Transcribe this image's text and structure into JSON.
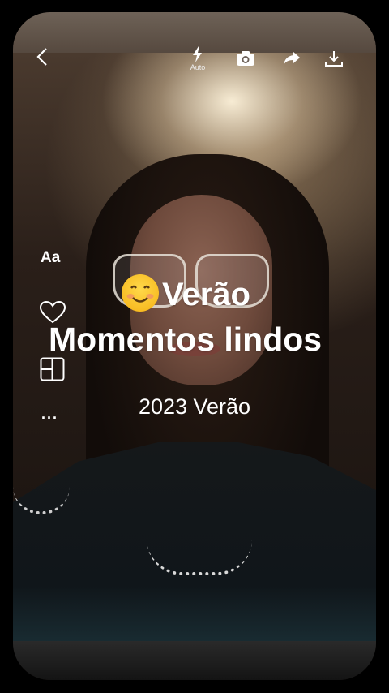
{
  "topbar": {
    "back_icon": "chevron-left-icon",
    "flash_icon": "flash-auto-icon",
    "flash_label": "Auto",
    "camera_icon": "camera-icon",
    "share_icon": "share-icon",
    "download_icon": "download-icon"
  },
  "side_tools": {
    "text_tool_label": "Aa",
    "like_icon": "heart-icon",
    "layout_icon": "layout-grid-icon",
    "more_label": "..."
  },
  "overlay": {
    "emoji": "smiling-face-emoji",
    "title_line1": "Verão",
    "title_line2": "Momentos lindos",
    "subtitle": "2023 Verão"
  },
  "colors": {
    "text": "#ffffff",
    "emoji_yellow": "#f7b91f",
    "background": "#000000"
  }
}
